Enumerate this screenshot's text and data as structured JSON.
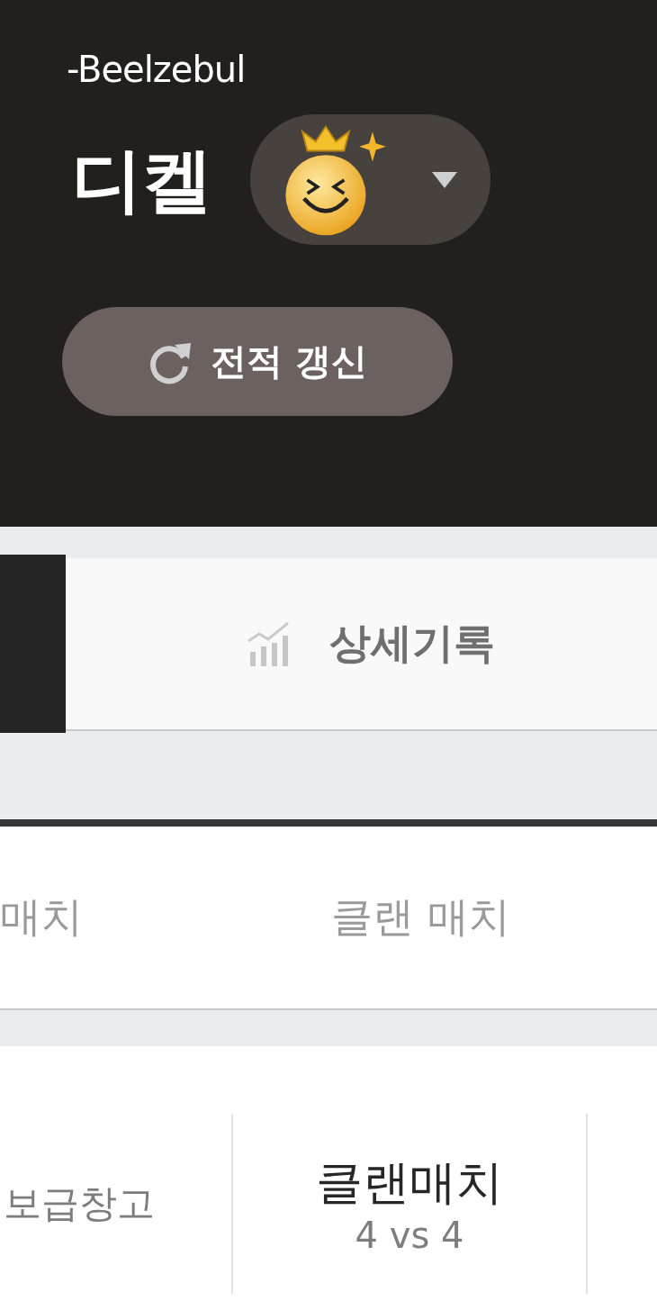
{
  "header": {
    "subtitle": "-Beelzebul",
    "nickname": "디켈",
    "refresh_button": "전적 갱신"
  },
  "tabs": [
    {
      "selected": true
    },
    {
      "label": "상세기록",
      "selected": false
    }
  ],
  "sub_tabs": [
    {
      "label": "매치",
      "selected": false
    },
    {
      "label": "클랜 매치",
      "selected": false
    }
  ],
  "match_row": {
    "map": "보급창고",
    "mode": "클랜매치",
    "team_size": "4 vs 4"
  }
}
